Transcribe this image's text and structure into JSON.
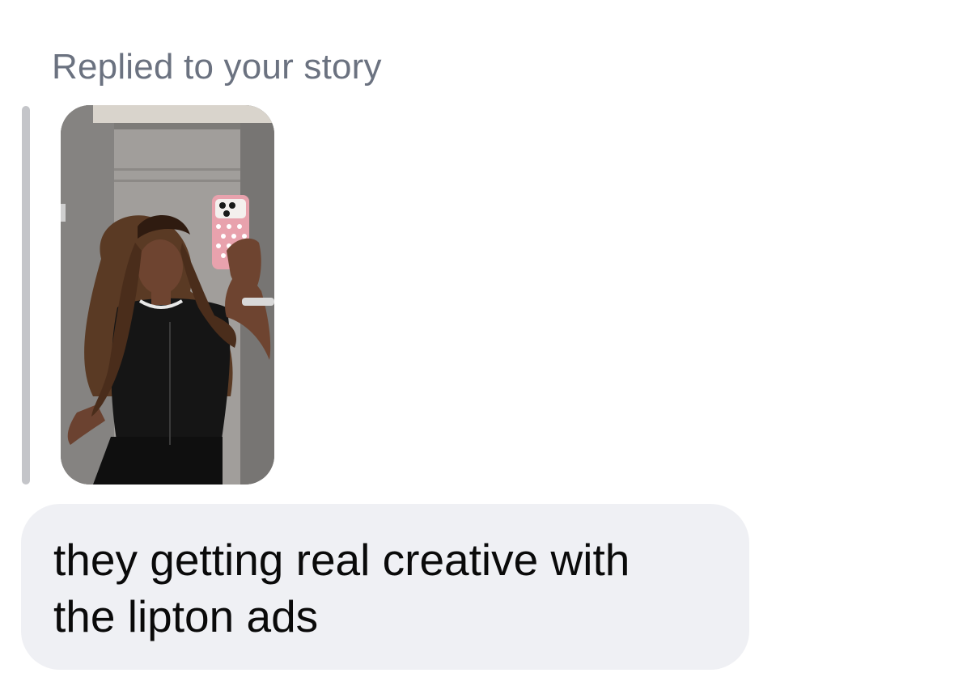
{
  "story_reply": {
    "header": "Replied to your story",
    "thumbnail_icon": "story-photo-thumbnail"
  },
  "message": {
    "text": "they getting real creative with\nthe lipton ads"
  },
  "colors": {
    "header_text": "#6b7280",
    "quote_bar": "#c4c5c9",
    "bubble_background": "#eff0f4",
    "message_text": "#0a0a0a"
  }
}
